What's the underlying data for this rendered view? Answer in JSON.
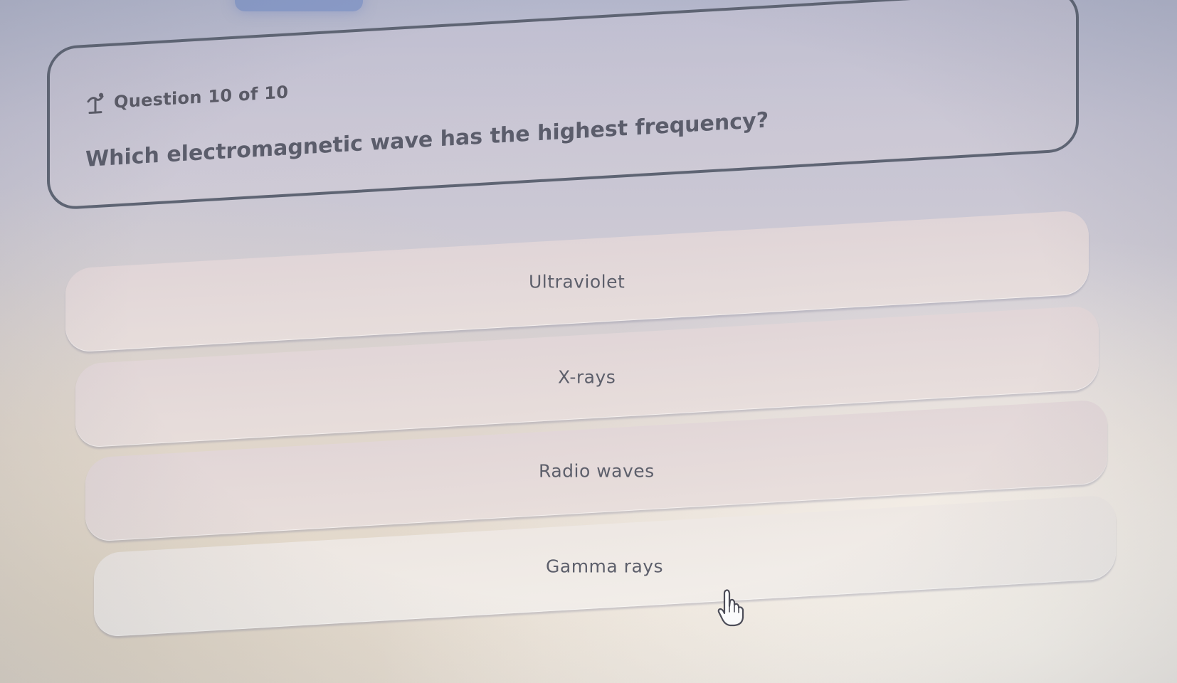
{
  "question": {
    "counter": "Question 10 of 10",
    "text": "Which electromagnetic wave has the highest frequency?",
    "icon": "pencil-flag-icon"
  },
  "options": [
    {
      "label": "Ultraviolet"
    },
    {
      "label": "X-rays"
    },
    {
      "label": "Radio waves"
    },
    {
      "label": "Gamma rays"
    }
  ],
  "cursor": {
    "icon": "hand-pointer-icon"
  }
}
